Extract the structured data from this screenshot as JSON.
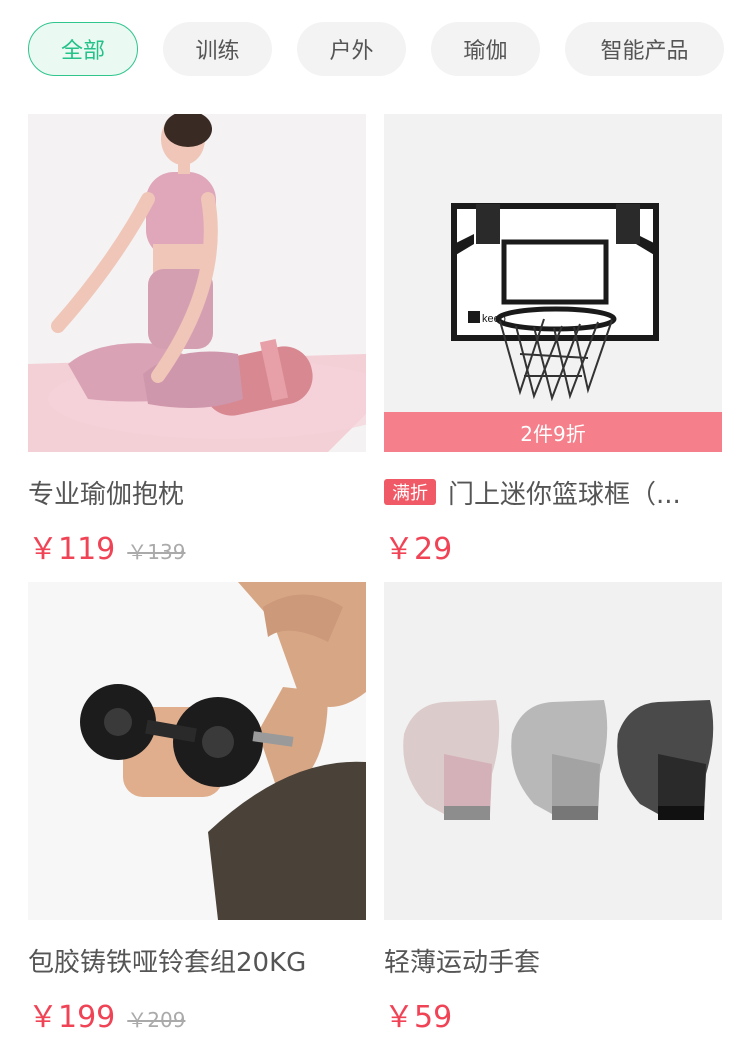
{
  "filters": [
    "全部",
    "训练",
    "户外",
    "瑜伽",
    "智能产品"
  ],
  "colors": {
    "accent_green": "#24c189",
    "price_red": "#f04456",
    "promo_pink": "#f57f8a",
    "tag_red": "#f05a66"
  },
  "products": [
    {
      "title": "专业瑜伽抱枕",
      "price": "￥119",
      "original_price": "￥139",
      "image_icon": "yoga-woman-bolster-icon"
    },
    {
      "title": "门上迷你篮球框（...",
      "price": "￥29",
      "tag": "满折",
      "promo": "2件9折",
      "image_icon": "basketball-hoop-icon",
      "image_logo": "keep"
    },
    {
      "title": "包胶铸铁哑铃套组20KG",
      "price": "￥199",
      "original_price": "￥209",
      "image_icon": "dumbbell-curl-icon"
    },
    {
      "title": "轻薄运动手套",
      "price": "￥59",
      "image_icon": "gloves-icon"
    }
  ]
}
